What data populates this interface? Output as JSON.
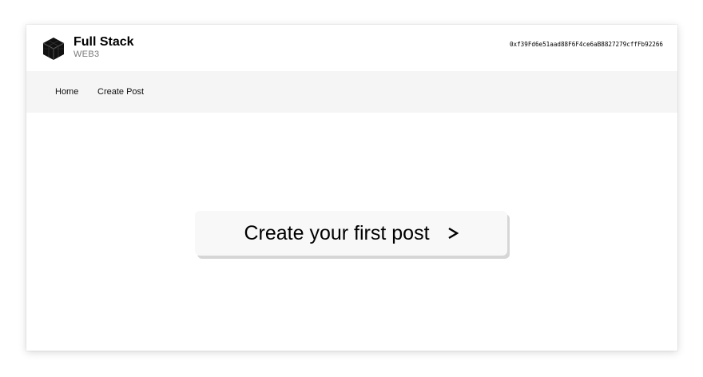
{
  "header": {
    "brand_title": "Full Stack",
    "brand_subtitle": "WEB3",
    "logo_icon": "cube-icon",
    "wallet_address": "0xf39Fd6e51aad88F6F4ce6aB8827279cffFb92266"
  },
  "nav": {
    "items": [
      {
        "label": "Home"
      },
      {
        "label": "Create Post"
      }
    ]
  },
  "main": {
    "cta_label": "Create your first post",
    "cta_icon": "chevron-right-icon"
  },
  "colors": {
    "nav_background": "#f5f5f5",
    "cta_background": "#f8f8f8",
    "cta_shadow": "#d6d6d6",
    "text": "#000000",
    "subtitle": "#7a7a7a"
  }
}
